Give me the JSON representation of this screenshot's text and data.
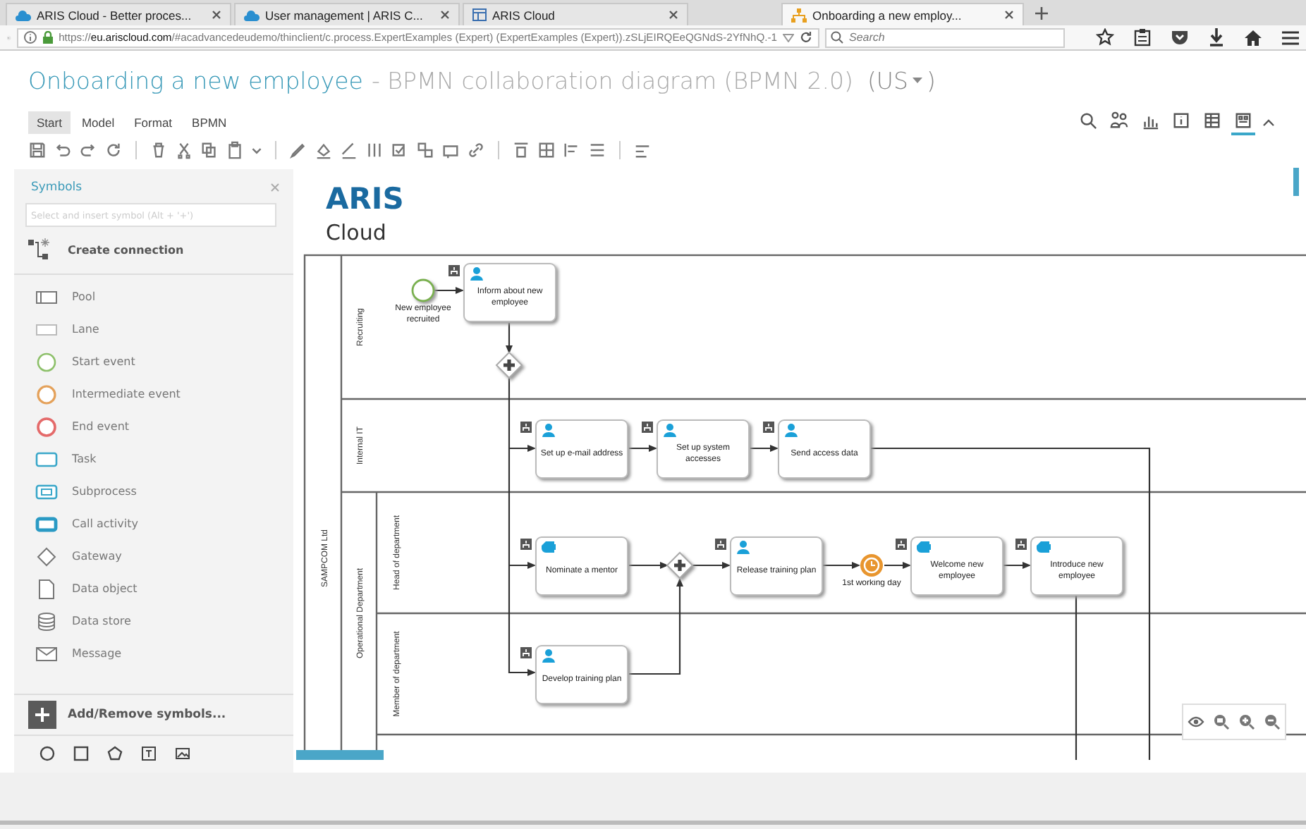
{
  "browser": {
    "tabs": [
      {
        "title": "ARIS Cloud - Better proces...",
        "kind": "cloud",
        "selected": false
      },
      {
        "title": "User management | ARIS C...",
        "kind": "cloud",
        "selected": false
      },
      {
        "title": "ARIS Cloud",
        "kind": "page",
        "selected": false
      },
      {
        "title": "Onboarding a new employ...",
        "kind": "diagram",
        "selected": true
      }
    ],
    "url": "https://**eu.ariscloud.com**/#acadvancedeudemo/thinclient/c.process.ExpertExamples (Expert) (ExpertExamples (Expert)).zSLjEIRQEeQGNdS-2YfNhQ.-1",
    "search": {
      "placeholder": "Search"
    }
  },
  "header": {
    "model_name": "Onboarding a new employee",
    "model_type": "- BPMN collaboration diagram (BPMN 2.0)",
    "language": "(US",
    "language_end": ")"
  },
  "ribbon_tabs": [
    {
      "label": "Start",
      "selected": true
    },
    {
      "label": "Model",
      "selected": false
    },
    {
      "label": "Format",
      "selected": false
    },
    {
      "label": "BPMN",
      "selected": false
    }
  ],
  "view_buttons": [
    {
      "kind": "search",
      "selected": false
    },
    {
      "kind": "people",
      "selected": false
    },
    {
      "kind": "chart",
      "selected": false
    },
    {
      "kind": "info",
      "selected": false
    },
    {
      "kind": "table",
      "selected": false
    },
    {
      "kind": "layout",
      "selected": true
    }
  ],
  "symbols": {
    "title": "Symbols",
    "search": {
      "placeholder": "Select and insert symbol (Alt + '+')"
    },
    "create_connection": "Create connection",
    "items": [
      {
        "kind": "pool",
        "label": "Pool"
      },
      {
        "kind": "lane",
        "label": "Lane"
      },
      {
        "kind": "start_event",
        "label": "Start event"
      },
      {
        "kind": "intermediate_event",
        "label": "Intermediate event"
      },
      {
        "kind": "end_event",
        "label": "End event"
      },
      {
        "kind": "task",
        "label": "Task"
      },
      {
        "kind": "subprocess",
        "label": "Subprocess"
      },
      {
        "kind": "call_activity",
        "label": "Call activity"
      },
      {
        "kind": "gateway",
        "label": "Gateway"
      },
      {
        "kind": "data_object",
        "label": "Data object"
      },
      {
        "kind": "data_store",
        "label": "Data store"
      },
      {
        "kind": "message",
        "label": "Message"
      }
    ],
    "add_remove": "Add/Remove symbols..."
  },
  "logo": {
    "name": "ARIS",
    "subtitle": "Cloud"
  },
  "diagram": {
    "pool": "SAMPCOM Ltd",
    "lanes": [
      {
        "label": "Recruiting"
      },
      {
        "label": "Internal IT"
      },
      {
        "label": "Operational Department",
        "children": [
          {
            "label": "Head of department"
          },
          {
            "label": "Member of department"
          }
        ]
      }
    ],
    "nodes": [
      {
        "kind": "start_event",
        "label": "New employee recruited"
      },
      {
        "kind": "user_task",
        "label": "Inform about new employee"
      },
      {
        "kind": "gateway"
      },
      {
        "kind": "user_task",
        "label": "Set up e-mail address"
      },
      {
        "kind": "user_task",
        "label": "Set up system accesses"
      },
      {
        "kind": "user_task",
        "label": "Send access data"
      },
      {
        "kind": "manual_task",
        "label": "Nominate a mentor"
      },
      {
        "kind": "gateway"
      },
      {
        "kind": "user_task",
        "label": "Release training plan"
      },
      {
        "kind": "timer_event",
        "label": "1st working day"
      },
      {
        "kind": "manual_task",
        "label": "Welcome new employee"
      },
      {
        "kind": "manual_task",
        "label": "Introduce new employee"
      },
      {
        "kind": "user_task",
        "label": "Develop training plan"
      }
    ]
  }
}
